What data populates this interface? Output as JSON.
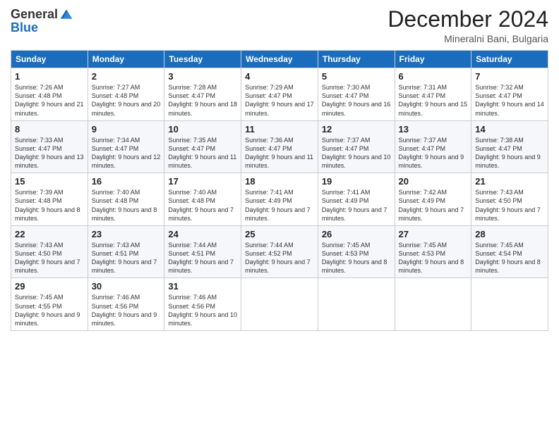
{
  "header": {
    "logo_general": "General",
    "logo_blue": "Blue",
    "month_title": "December 2024",
    "subtitle": "Mineralni Bani, Bulgaria"
  },
  "weekdays": [
    "Sunday",
    "Monday",
    "Tuesday",
    "Wednesday",
    "Thursday",
    "Friday",
    "Saturday"
  ],
  "weeks": [
    [
      {
        "day": "1",
        "sunrise": "Sunrise: 7:26 AM",
        "sunset": "Sunset: 4:48 PM",
        "daylight": "Daylight: 9 hours and 21 minutes."
      },
      {
        "day": "2",
        "sunrise": "Sunrise: 7:27 AM",
        "sunset": "Sunset: 4:48 PM",
        "daylight": "Daylight: 9 hours and 20 minutes."
      },
      {
        "day": "3",
        "sunrise": "Sunrise: 7:28 AM",
        "sunset": "Sunset: 4:47 PM",
        "daylight": "Daylight: 9 hours and 18 minutes."
      },
      {
        "day": "4",
        "sunrise": "Sunrise: 7:29 AM",
        "sunset": "Sunset: 4:47 PM",
        "daylight": "Daylight: 9 hours and 17 minutes."
      },
      {
        "day": "5",
        "sunrise": "Sunrise: 7:30 AM",
        "sunset": "Sunset: 4:47 PM",
        "daylight": "Daylight: 9 hours and 16 minutes."
      },
      {
        "day": "6",
        "sunrise": "Sunrise: 7:31 AM",
        "sunset": "Sunset: 4:47 PM",
        "daylight": "Daylight: 9 hours and 15 minutes."
      },
      {
        "day": "7",
        "sunrise": "Sunrise: 7:32 AM",
        "sunset": "Sunset: 4:47 PM",
        "daylight": "Daylight: 9 hours and 14 minutes."
      }
    ],
    [
      {
        "day": "8",
        "sunrise": "Sunrise: 7:33 AM",
        "sunset": "Sunset: 4:47 PM",
        "daylight": "Daylight: 9 hours and 13 minutes."
      },
      {
        "day": "9",
        "sunrise": "Sunrise: 7:34 AM",
        "sunset": "Sunset: 4:47 PM",
        "daylight": "Daylight: 9 hours and 12 minutes."
      },
      {
        "day": "10",
        "sunrise": "Sunrise: 7:35 AM",
        "sunset": "Sunset: 4:47 PM",
        "daylight": "Daylight: 9 hours and 11 minutes."
      },
      {
        "day": "11",
        "sunrise": "Sunrise: 7:36 AM",
        "sunset": "Sunset: 4:47 PM",
        "daylight": "Daylight: 9 hours and 11 minutes."
      },
      {
        "day": "12",
        "sunrise": "Sunrise: 7:37 AM",
        "sunset": "Sunset: 4:47 PM",
        "daylight": "Daylight: 9 hours and 10 minutes."
      },
      {
        "day": "13",
        "sunrise": "Sunrise: 7:37 AM",
        "sunset": "Sunset: 4:47 PM",
        "daylight": "Daylight: 9 hours and 9 minutes."
      },
      {
        "day": "14",
        "sunrise": "Sunrise: 7:38 AM",
        "sunset": "Sunset: 4:47 PM",
        "daylight": "Daylight: 9 hours and 9 minutes."
      }
    ],
    [
      {
        "day": "15",
        "sunrise": "Sunrise: 7:39 AM",
        "sunset": "Sunset: 4:48 PM",
        "daylight": "Daylight: 9 hours and 8 minutes."
      },
      {
        "day": "16",
        "sunrise": "Sunrise: 7:40 AM",
        "sunset": "Sunset: 4:48 PM",
        "daylight": "Daylight: 9 hours and 8 minutes."
      },
      {
        "day": "17",
        "sunrise": "Sunrise: 7:40 AM",
        "sunset": "Sunset: 4:48 PM",
        "daylight": "Daylight: 9 hours and 7 minutes."
      },
      {
        "day": "18",
        "sunrise": "Sunrise: 7:41 AM",
        "sunset": "Sunset: 4:49 PM",
        "daylight": "Daylight: 9 hours and 7 minutes."
      },
      {
        "day": "19",
        "sunrise": "Sunrise: 7:41 AM",
        "sunset": "Sunset: 4:49 PM",
        "daylight": "Daylight: 9 hours and 7 minutes."
      },
      {
        "day": "20",
        "sunrise": "Sunrise: 7:42 AM",
        "sunset": "Sunset: 4:49 PM",
        "daylight": "Daylight: 9 hours and 7 minutes."
      },
      {
        "day": "21",
        "sunrise": "Sunrise: 7:43 AM",
        "sunset": "Sunset: 4:50 PM",
        "daylight": "Daylight: 9 hours and 7 minutes."
      }
    ],
    [
      {
        "day": "22",
        "sunrise": "Sunrise: 7:43 AM",
        "sunset": "Sunset: 4:50 PM",
        "daylight": "Daylight: 9 hours and 7 minutes."
      },
      {
        "day": "23",
        "sunrise": "Sunrise: 7:43 AM",
        "sunset": "Sunset: 4:51 PM",
        "daylight": "Daylight: 9 hours and 7 minutes."
      },
      {
        "day": "24",
        "sunrise": "Sunrise: 7:44 AM",
        "sunset": "Sunset: 4:51 PM",
        "daylight": "Daylight: 9 hours and 7 minutes."
      },
      {
        "day": "25",
        "sunrise": "Sunrise: 7:44 AM",
        "sunset": "Sunset: 4:52 PM",
        "daylight": "Daylight: 9 hours and 7 minutes."
      },
      {
        "day": "26",
        "sunrise": "Sunrise: 7:45 AM",
        "sunset": "Sunset: 4:53 PM",
        "daylight": "Daylight: 9 hours and 8 minutes."
      },
      {
        "day": "27",
        "sunrise": "Sunrise: 7:45 AM",
        "sunset": "Sunset: 4:53 PM",
        "daylight": "Daylight: 9 hours and 8 minutes."
      },
      {
        "day": "28",
        "sunrise": "Sunrise: 7:45 AM",
        "sunset": "Sunset: 4:54 PM",
        "daylight": "Daylight: 9 hours and 8 minutes."
      }
    ],
    [
      {
        "day": "29",
        "sunrise": "Sunrise: 7:45 AM",
        "sunset": "Sunset: 4:55 PM",
        "daylight": "Daylight: 9 hours and 9 minutes."
      },
      {
        "day": "30",
        "sunrise": "Sunrise: 7:46 AM",
        "sunset": "Sunset: 4:56 PM",
        "daylight": "Daylight: 9 hours and 9 minutes."
      },
      {
        "day": "31",
        "sunrise": "Sunrise: 7:46 AM",
        "sunset": "Sunset: 4:56 PM",
        "daylight": "Daylight: 9 hours and 10 minutes."
      },
      null,
      null,
      null,
      null
    ]
  ]
}
